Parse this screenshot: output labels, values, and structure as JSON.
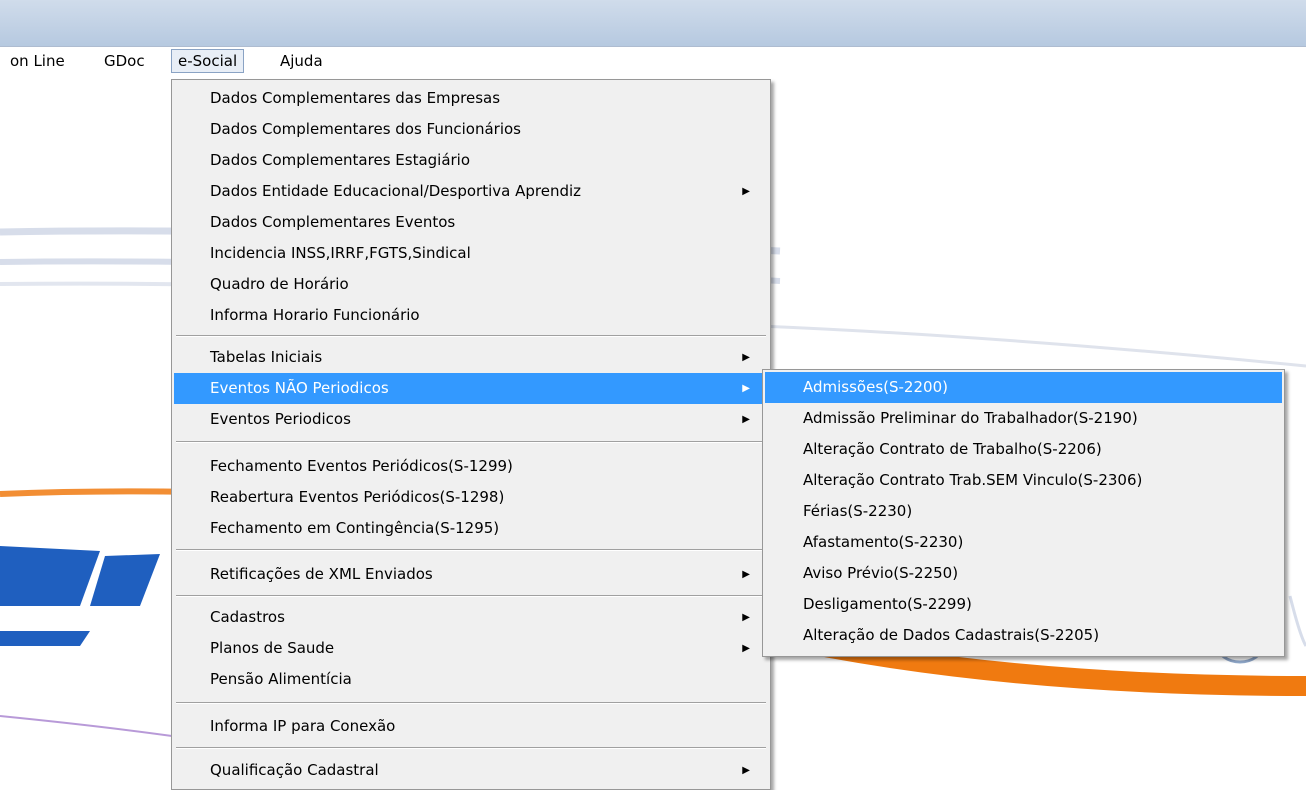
{
  "menubar": {
    "items": [
      {
        "label": "on Line"
      },
      {
        "label": "GDoc"
      },
      {
        "label": "e-Social"
      },
      {
        "label": "Ajuda"
      }
    ]
  },
  "esocial_menu": {
    "items": [
      {
        "label": "Dados Complementares das Empresas"
      },
      {
        "label": "Dados Complementares dos Funcionários"
      },
      {
        "label": "Dados Complementares Estagiário"
      },
      {
        "label": "Dados Entidade Educacional/Desportiva Aprendiz"
      },
      {
        "label": "Dados Complementares Eventos"
      },
      {
        "label": "Incidencia INSS,IRRF,FGTS,Sindical"
      },
      {
        "label": "Quadro de Horário"
      },
      {
        "label": "Informa Horario Funcionário"
      },
      {
        "label": "Tabelas Iniciais"
      },
      {
        "label": "Eventos NÃO Periodicos"
      },
      {
        "label": "Eventos Periodicos"
      },
      {
        "label": "Fechamento Eventos Periódicos(S-1299)"
      },
      {
        "label": "Reabertura Eventos Periódicos(S-1298)"
      },
      {
        "label": "Fechamento em Contingência(S-1295)"
      },
      {
        "label": "Retificações de XML Enviados"
      },
      {
        "label": "Cadastros"
      },
      {
        "label": "Planos de Saude"
      },
      {
        "label": "Pensão Alimentícia"
      },
      {
        "label": "Informa IP para Conexão"
      },
      {
        "label": "Qualificação Cadastral"
      }
    ]
  },
  "submenu_arrow": "▶",
  "eventos_nao_periodicos_submenu": {
    "items": [
      {
        "label": "Admissões(S-2200)"
      },
      {
        "label": "Admissão Preliminar do Trabalhador(S-2190)"
      },
      {
        "label": "Alteração Contrato de Trabalho(S-2206)"
      },
      {
        "label": "Alteração Contrato Trab.SEM Vinculo(S-2306)"
      },
      {
        "label": "Férias(S-2230)"
      },
      {
        "label": "Afastamento(S-2230)"
      },
      {
        "label": "Aviso Prévio(S-2250)"
      },
      {
        "label": "Desligamento(S-2299)"
      },
      {
        "label": "Alteração de Dados Cadastrais(S-2205)"
      }
    ]
  },
  "colors": {
    "highlight": "#3399ff",
    "menu_bg": "#f0f0f0",
    "logo_blue": "#1f5fbf",
    "logo_orange": "#f07a10"
  }
}
